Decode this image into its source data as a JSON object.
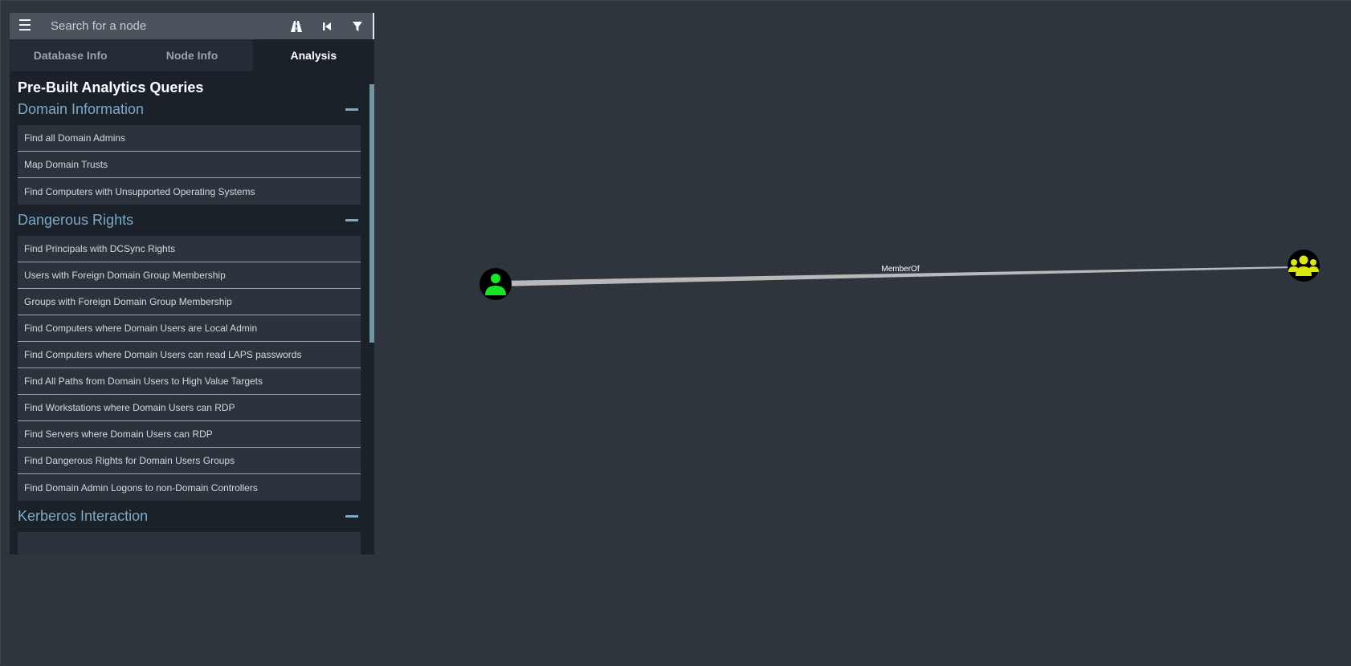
{
  "search": {
    "placeholder": "Search for a node"
  },
  "toolbar": {
    "menu_icon": "hamburger-icon",
    "pathfinding_icon": "road-icon",
    "back_icon": "step-back-icon",
    "filter_icon": "filter-icon"
  },
  "tabs": [
    {
      "label": "Database Info",
      "active": false
    },
    {
      "label": "Node Info",
      "active": false
    },
    {
      "label": "Analysis",
      "active": true
    }
  ],
  "analysis": {
    "title": "Pre-Built Analytics Queries",
    "sections": [
      {
        "title": "Domain Information",
        "queries": [
          "Find all Domain Admins",
          "Map Domain Trusts",
          "Find Computers with Unsupported Operating Systems"
        ]
      },
      {
        "title": "Dangerous Rights",
        "queries": [
          "Find Principals with DCSync Rights",
          "Users with Foreign Domain Group Membership",
          "Groups with Foreign Domain Group Membership",
          "Find Computers where Domain Users are Local Admin",
          "Find Computers where Domain Users can read LAPS passwords",
          "Find All Paths from Domain Users to High Value Targets",
          "Find Workstations where Domain Users can RDP",
          "Find Servers where Domain Users can RDP",
          "Find Dangerous Rights for Domain Users Groups",
          "Find Domain Admin Logons to non-Domain Controllers"
        ]
      },
      {
        "title": "Kerberos Interaction",
        "queries": [
          ""
        ]
      }
    ]
  },
  "graph": {
    "nodes": [
      {
        "id": "user",
        "type": "user",
        "icon": "user-icon",
        "color": "#17e625"
      },
      {
        "id": "group",
        "type": "group",
        "icon": "group-icon",
        "color": "#dbe617"
      }
    ],
    "edges": [
      {
        "from": "user",
        "to": "group",
        "label": "MemberOf"
      }
    ]
  },
  "colors": {
    "background": "#2e353d",
    "panel": "#1b2129",
    "section_title": "#7fa8c6",
    "user_node": "#17e625",
    "group_node": "#dbe617"
  }
}
